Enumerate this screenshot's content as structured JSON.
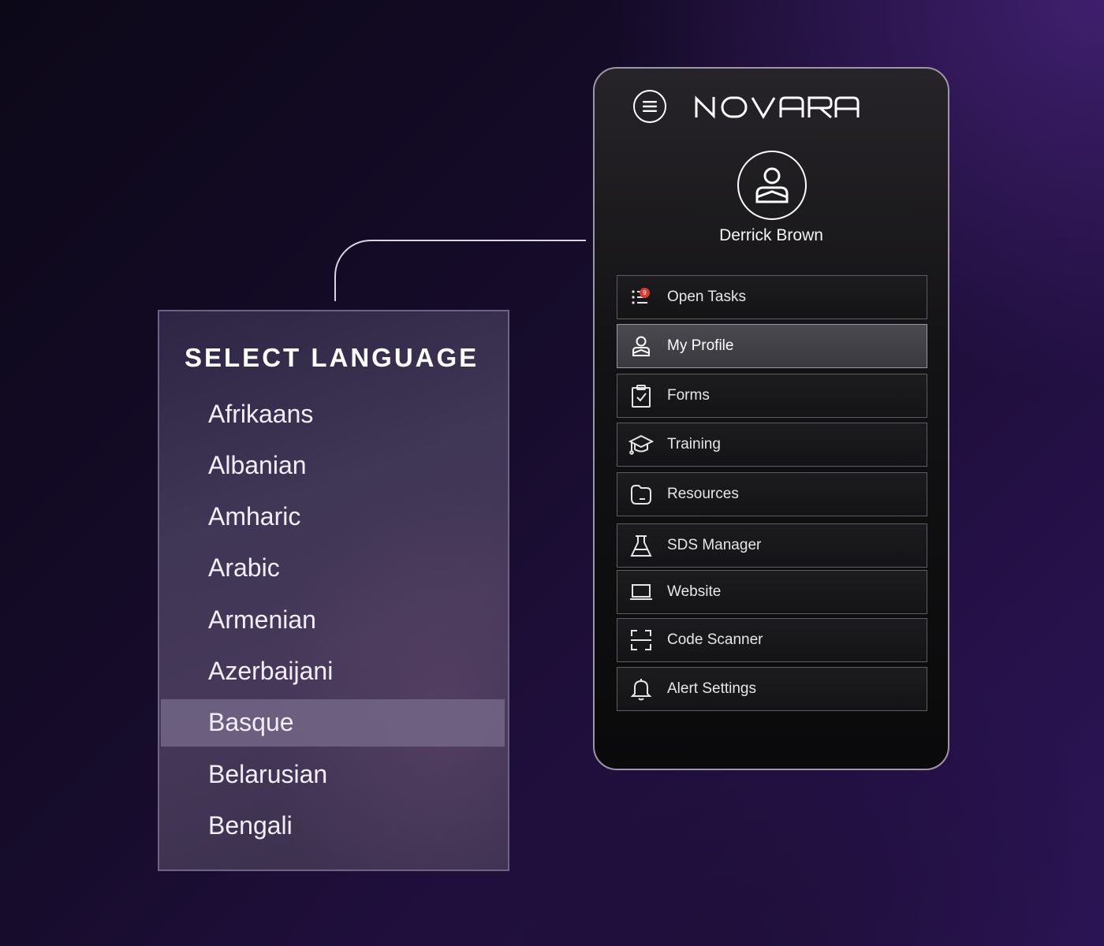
{
  "language_panel": {
    "title": "SELECT LANGUAGE",
    "languages": [
      "Afrikaans",
      "Albanian",
      "Amharic",
      "Arabic",
      "Armenian",
      "Azerbaijani",
      "Basque",
      "Belarusian",
      "Bengali"
    ],
    "selected": "Basque"
  },
  "app": {
    "brand": "NOVARA",
    "user_name": "Derrick Brown",
    "menu": [
      {
        "label": "Open Tasks",
        "icon": "task-list-icon",
        "badge": "9"
      },
      {
        "label": "My Profile",
        "icon": "user-icon",
        "active": true
      },
      {
        "label": "Forms",
        "icon": "clipboard-check-icon"
      },
      {
        "label": "Training",
        "icon": "graduation-cap-icon"
      },
      {
        "label": "Resources",
        "icon": "folder-icon"
      },
      {
        "label": "SDS Manager",
        "icon": "flask-icon"
      },
      {
        "label": "Website",
        "icon": "laptop-icon"
      },
      {
        "label": "Code Scanner",
        "icon": "scan-frame-icon"
      },
      {
        "label": "Alert Settings",
        "icon": "bell-icon"
      }
    ]
  },
  "colors": {
    "background_dark": "#0c0818",
    "background_purple": "#3f1f6e",
    "panel": "#403656",
    "selected_row": "#786c8c",
    "phone": "#131214",
    "badge": "#d8392f",
    "border": "#5e5c63"
  }
}
